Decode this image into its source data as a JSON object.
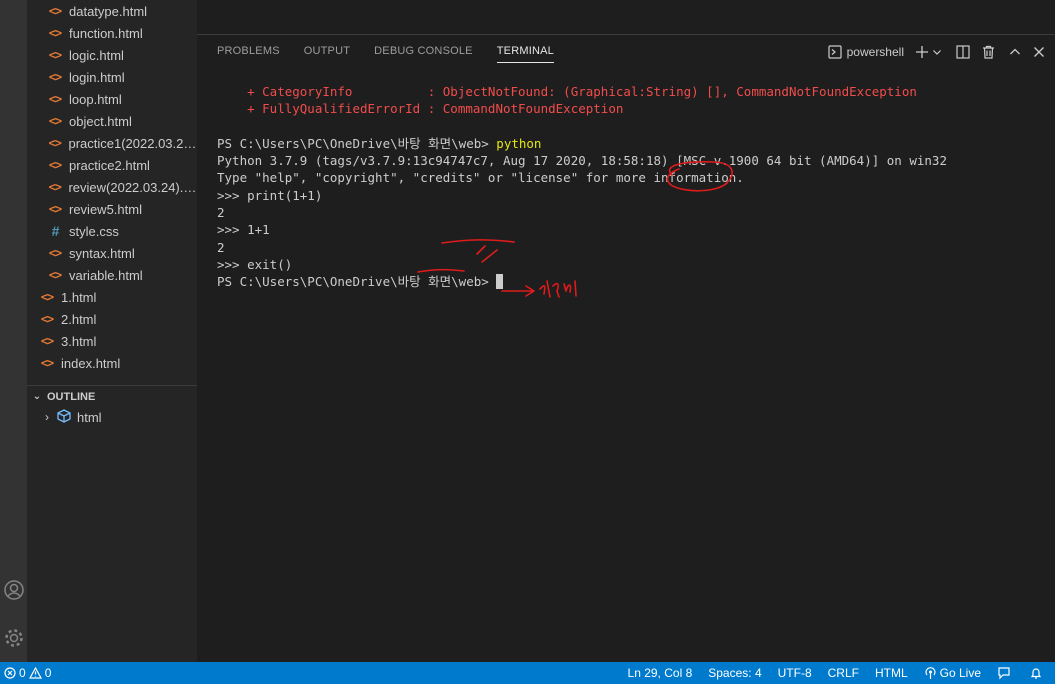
{
  "explorer": {
    "files": [
      {
        "name": "datatype.html",
        "type": "html"
      },
      {
        "name": "function.html",
        "type": "html"
      },
      {
        "name": "logic.html",
        "type": "html"
      },
      {
        "name": "login.html",
        "type": "html"
      },
      {
        "name": "loop.html",
        "type": "html"
      },
      {
        "name": "object.html",
        "type": "html"
      },
      {
        "name": "practice1(2022.03.23...",
        "type": "html"
      },
      {
        "name": "practice2.html",
        "type": "html"
      },
      {
        "name": "review(2022.03.24).h...",
        "type": "html"
      },
      {
        "name": "review5.html",
        "type": "html"
      },
      {
        "name": "style.css",
        "type": "css"
      },
      {
        "name": "syntax.html",
        "type": "html"
      },
      {
        "name": "variable.html",
        "type": "html"
      }
    ],
    "root_files": [
      {
        "name": "1.html",
        "type": "html"
      },
      {
        "name": "2.html",
        "type": "html"
      },
      {
        "name": "3.html",
        "type": "html"
      },
      {
        "name": "index.html",
        "type": "html"
      }
    ]
  },
  "outline": {
    "header": "OUTLINE",
    "item": "html"
  },
  "panel": {
    "tabs": [
      "PROBLEMS",
      "OUTPUT",
      "DEBUG CONSOLE",
      "TERMINAL"
    ],
    "active_tab": "TERMINAL",
    "shell": "powershell"
  },
  "terminal": {
    "error_line_1": "    + CategoryInfo          : ObjectNotFound: (Graphical:String) [], CommandNotFoundException",
    "error_line_2": "    + FullyQualifiedErrorId : CommandNotFoundException",
    "prompt": "PS C:\\Users\\PC\\OneDrive\\바탕 화면\\web> ",
    "command": "python",
    "banner_1": "Python 3.7.9 (tags/v3.7.9:13c94747c7, Aug 17 2020, 18:58:18) [MSC v.1900 64 bit (AMD64)] on win32",
    "banner_2": "Type \"help\", \"copyright\", \"credits\" or \"license\" for more information.",
    "line_print": ">>> print(1+1)",
    "out_1": "2",
    "line_add": ">>> 1+1",
    "out_2": "2",
    "line_exit": ">>> exit()",
    "final_prompt": "PS C:\\Users\\PC\\OneDrive\\바탕 화면\\web> "
  },
  "status_bar": {
    "errors": "0",
    "warnings": "0",
    "position": "Ln 29, Col 8",
    "spaces": "Spaces: 4",
    "encoding": "UTF-8",
    "eol": "CRLF",
    "language": "HTML",
    "go_live": "Go Live"
  },
  "colors": {
    "status_bar": "#007acc",
    "error_text": "#f14c4c",
    "command_text": "#e5e510",
    "annotation": "#e01b1b"
  }
}
